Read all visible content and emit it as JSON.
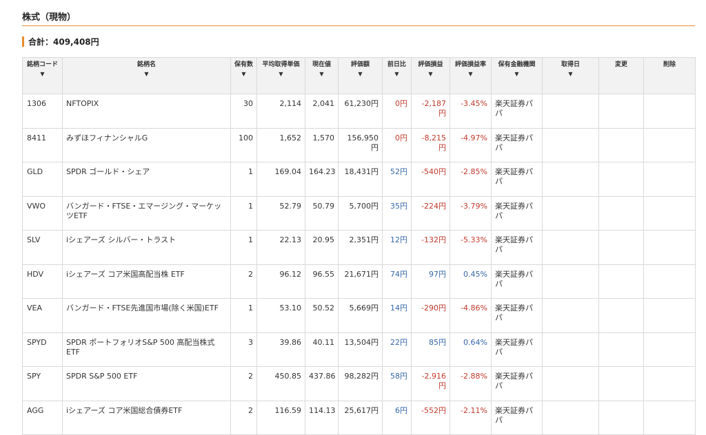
{
  "section": {
    "title": "株式（現物）"
  },
  "total": {
    "label": "合計：409,408円"
  },
  "columns": [
    {
      "label": "銘柄コード",
      "arrow": "▼"
    },
    {
      "label": "銘柄名",
      "arrow": "▼"
    },
    {
      "label": "保有数",
      "arrow": "▼"
    },
    {
      "label": "平均取得単価",
      "arrow": "▼"
    },
    {
      "label": "現在値",
      "arrow": "▼"
    },
    {
      "label": "評価額",
      "arrow": "▼"
    },
    {
      "label": "前日比",
      "arrow": "▼"
    },
    {
      "label": "評価損益",
      "arrow": "▼"
    },
    {
      "label": "評価損益率",
      "arrow": "▼"
    },
    {
      "label": "保有金融機関",
      "arrow": "▼"
    },
    {
      "label": "取得日",
      "arrow": "▼"
    },
    {
      "label": "変更",
      "arrow": ""
    },
    {
      "label": "削除",
      "arrow": ""
    }
  ],
  "rows": [
    {
      "code": "1306",
      "name": "NFTOPIX",
      "qty": "30",
      "avg": "2,114",
      "price": "2,041",
      "value": "61,230円",
      "change": "0円",
      "change_sign": "zero",
      "pl": "-2,187円",
      "pl_sign": "neg",
      "rate": "-3.45%",
      "rate_sign": "neg",
      "broker": "楽天証券パパ",
      "acquired": "",
      "edit": "",
      "delete": ""
    },
    {
      "code": "8411",
      "name": "みずほフィナンシャルG",
      "qty": "100",
      "avg": "1,652",
      "price": "1,570",
      "value": "156,950円",
      "change": "0円",
      "change_sign": "zero",
      "pl": "-8,215円",
      "pl_sign": "neg",
      "rate": "-4.97%",
      "rate_sign": "neg",
      "broker": "楽天証券パパ",
      "acquired": "",
      "edit": "",
      "delete": ""
    },
    {
      "code": "GLD",
      "name": "SPDR ゴールド・シェア",
      "qty": "1",
      "avg": "169.04",
      "price": "164.23",
      "value": "18,431円",
      "change": "52円",
      "change_sign": "pos",
      "pl": "-540円",
      "pl_sign": "neg",
      "rate": "-2.85%",
      "rate_sign": "neg",
      "broker": "楽天証券パパ",
      "acquired": "",
      "edit": "",
      "delete": ""
    },
    {
      "code": "VWO",
      "name": "バンガード・FTSE・エマージング・マーケッツETF",
      "qty": "1",
      "avg": "52.79",
      "price": "50.79",
      "value": "5,700円",
      "change": "35円",
      "change_sign": "pos",
      "pl": "-224円",
      "pl_sign": "neg",
      "rate": "-3.79%",
      "rate_sign": "neg",
      "broker": "楽天証券パパ",
      "acquired": "",
      "edit": "",
      "delete": ""
    },
    {
      "code": "SLV",
      "name": "iシェアーズ シルバー・トラスト",
      "qty": "1",
      "avg": "22.13",
      "price": "20.95",
      "value": "2,351円",
      "change": "12円",
      "change_sign": "pos",
      "pl": "-132円",
      "pl_sign": "neg",
      "rate": "-5.33%",
      "rate_sign": "neg",
      "broker": "楽天証券パパ",
      "acquired": "",
      "edit": "",
      "delete": ""
    },
    {
      "code": "HDV",
      "name": "iシェアーズ コア米国高配当株 ETF",
      "qty": "2",
      "avg": "96.12",
      "price": "96.55",
      "value": "21,671円",
      "change": "74円",
      "change_sign": "pos",
      "pl": "97円",
      "pl_sign": "pos",
      "rate": "0.45%",
      "rate_sign": "pos",
      "broker": "楽天証券パパ",
      "acquired": "",
      "edit": "",
      "delete": ""
    },
    {
      "code": "VEA",
      "name": "バンガード・FTSE先進国市場(除く米国)ETF",
      "qty": "1",
      "avg": "53.10",
      "price": "50.52",
      "value": "5,669円",
      "change": "14円",
      "change_sign": "pos",
      "pl": "-290円",
      "pl_sign": "neg",
      "rate": "-4.86%",
      "rate_sign": "neg",
      "broker": "楽天証券パパ",
      "acquired": "",
      "edit": "",
      "delete": ""
    },
    {
      "code": "SPYD",
      "name": "SPDR ポートフォリオS&P 500 高配当株式ETF",
      "qty": "3",
      "avg": "39.86",
      "price": "40.11",
      "value": "13,504円",
      "change": "22円",
      "change_sign": "pos",
      "pl": "85円",
      "pl_sign": "pos",
      "rate": "0.64%",
      "rate_sign": "pos",
      "broker": "楽天証券パパ",
      "acquired": "",
      "edit": "",
      "delete": ""
    },
    {
      "code": "SPY",
      "name": "SPDR S&P 500 ETF",
      "qty": "2",
      "avg": "450.85",
      "price": "437.86",
      "value": "98,282円",
      "change": "58円",
      "change_sign": "pos",
      "pl": "-2,916円",
      "pl_sign": "neg",
      "rate": "-2.88%",
      "rate_sign": "neg",
      "broker": "楽天証券パパ",
      "acquired": "",
      "edit": "",
      "delete": ""
    },
    {
      "code": "AGG",
      "name": "iシェアーズ コア米国総合債券ETF",
      "qty": "2",
      "avg": "116.59",
      "price": "114.13",
      "value": "25,617円",
      "change": "6円",
      "change_sign": "pos",
      "pl": "-552円",
      "pl_sign": "neg",
      "rate": "-2.11%",
      "rate_sign": "neg",
      "broker": "楽天証券パパ",
      "acquired": "",
      "edit": "",
      "delete": ""
    }
  ],
  "colors": {
    "accent": "#e98a2c",
    "positive": "#3566a8",
    "negative": "#c0392b",
    "header_bg": "#f2f2f2",
    "border": "#d9d9d9"
  }
}
